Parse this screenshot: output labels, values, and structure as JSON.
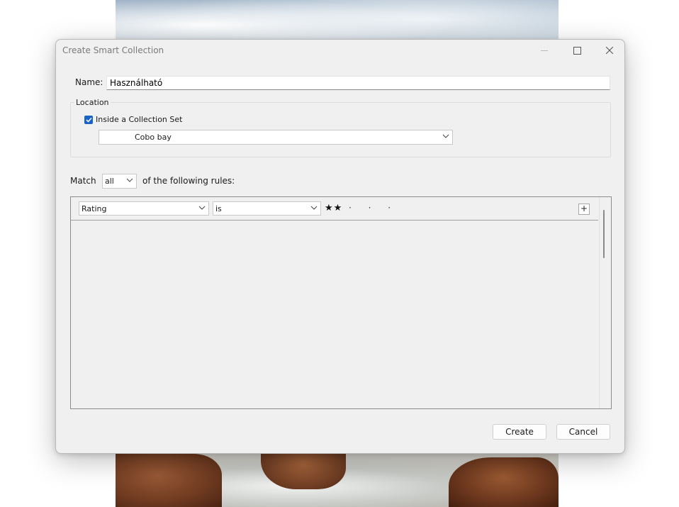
{
  "dialog": {
    "title": "Create Smart Collection",
    "name_label": "Name:",
    "name_value": "Használható",
    "location_legend": "Location",
    "inside_set_label": "Inside a Collection Set",
    "inside_set_checked": true,
    "collection_set_value": "Cobo bay",
    "match_label": "Match",
    "match_value": "all",
    "match_rest": "of the following rules:",
    "rules": [
      {
        "field": "Rating",
        "operator": "is",
        "stars_filled": "★★",
        "stars_empty": "· · ·",
        "rating_value": 2,
        "rating_max": 5
      }
    ],
    "add_rule_label": "+",
    "create_label": "Create",
    "cancel_label": "Cancel"
  },
  "window_controls": {
    "minimize": "minimize-icon",
    "maximize": "maximize-icon",
    "close": "close-icon"
  },
  "colors": {
    "checkbox_accent": "#1a62c6",
    "dialog_bg": "#f0f0f0"
  }
}
